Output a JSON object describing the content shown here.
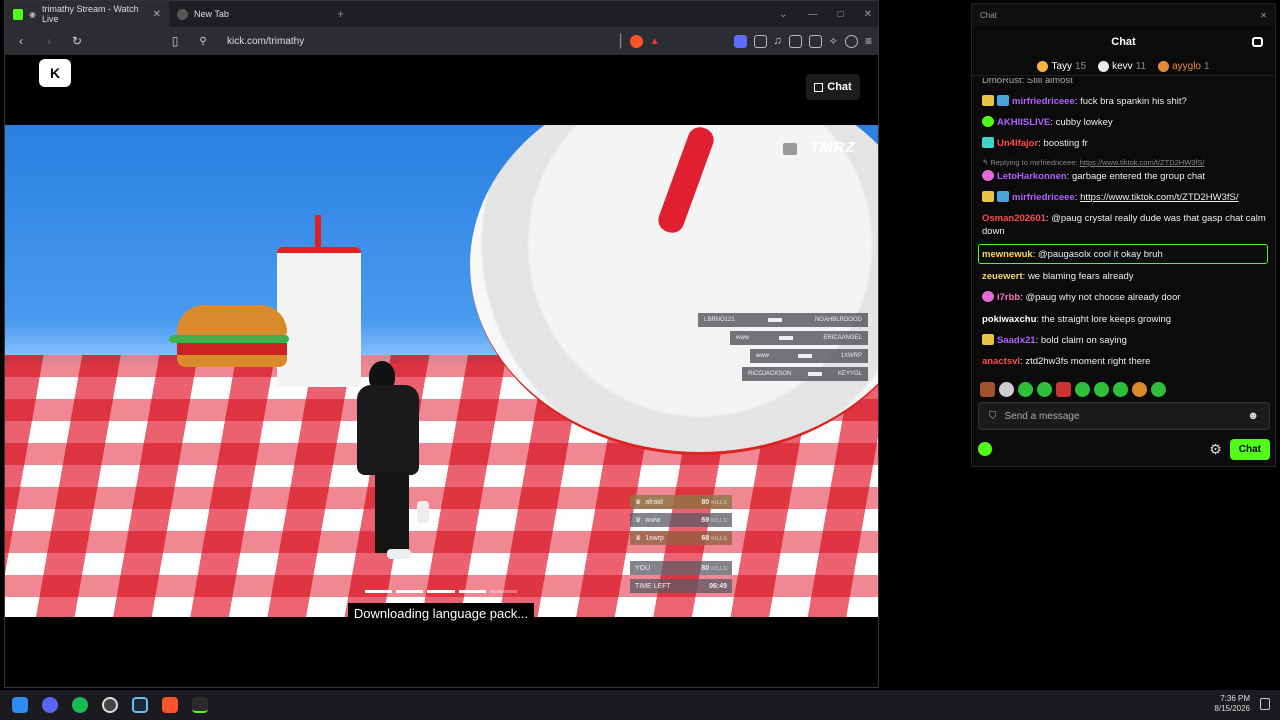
{
  "browser": {
    "tabs": [
      {
        "title": "trimathy Stream - Watch Live",
        "active": true
      },
      {
        "title": "New Tab",
        "active": false
      }
    ],
    "new_tab_symbol": "+",
    "url": "kick.com/trimathy",
    "window_controls": [
      "—",
      "□",
      "✕"
    ]
  },
  "page": {
    "chat_toggle_label": "Chat",
    "logo_text": "K"
  },
  "game": {
    "brand": "TMRZ",
    "killfeed": [
      {
        "killer": "LBRNO121",
        "victim": "NOAHBLRDOOD"
      },
      {
        "killer": "www",
        "victim": "ERICAANGEL"
      },
      {
        "killer": "www",
        "victim": "1XWRP"
      },
      {
        "killer": "RICOJACKSON",
        "victim": "KEYYGL"
      }
    ],
    "leaderboard": [
      {
        "name": "afraid",
        "value": "80",
        "unit": "KILLS"
      },
      {
        "name": "www",
        "value": "69",
        "unit": "KILLS"
      },
      {
        "name": "1xwrp",
        "value": "68",
        "unit": "KILLS"
      }
    ],
    "you": {
      "label": "YOU",
      "value": "80",
      "unit": "KILLS"
    },
    "time_left": {
      "label": "TIME LEFT",
      "value": "06:49"
    },
    "loading_progress": 0.8
  },
  "caption": "Downloading language pack...",
  "chat": {
    "window_title": "Chat",
    "header": "Chat",
    "gifters": [
      {
        "name": "Tayy",
        "count": "15",
        "color": "#f5b63b"
      },
      {
        "name": "kevv",
        "count": "11",
        "color": "#e9e9e9"
      },
      {
        "name": "ayyglo",
        "count": "1",
        "color": "#e58a3a"
      }
    ],
    "messages": [
      {
        "user": "mirfriedriceee",
        "color": "#b061ff",
        "badge": "#e8c547",
        "text": "fuck bra spankin his shit?"
      },
      {
        "user": "AKHIISLIVE",
        "color": "#b061ff",
        "badge": "#53fc18",
        "text": "cubby lowkey"
      },
      {
        "user": "Un4lfajor",
        "color": "#ff4d4d",
        "badge": "#3fd6c7",
        "text": "boosting fr"
      },
      {
        "user": "LetoHarkonnen",
        "color": "#b061ff",
        "badge": "#e26bd6",
        "text": "garbage entered the group chat"
      },
      {
        "user": "mirfriedriceee",
        "color": "#b061ff",
        "badge": "#e8c547",
        "text": "https://www.tiktok.com/t/ZTD2HW3fS/"
      },
      {
        "user": "Osman202601",
        "color": "#ff4d4d",
        "badge": "",
        "text": "@paug crystal really dude was that gasp chat calm down"
      },
      {
        "user": "mewnewuk",
        "color": "#f5d76e",
        "badge": "",
        "text": "@paugasolx cool it okay bruh"
      },
      {
        "user": "zeuewert",
        "color": "#f5d76e",
        "badge": "",
        "text": "we blaming fears already"
      },
      {
        "user": "i7rbb",
        "color": "#ff6ec7",
        "badge": "#e26bd6",
        "text": "@paug why not choose already door"
      },
      {
        "user": "pokiwaxchu",
        "color": "#ffffff",
        "badge": "",
        "text": "the straight lore keeps growing"
      },
      {
        "user": "Saadx21",
        "color": "#b061ff",
        "badge": "#e8c547",
        "text": "bold claim on saying"
      },
      {
        "user": "anactsvl",
        "color": "#ff4d4d",
        "badge": "",
        "text": "ztd2hw3fs moment right there"
      }
    ],
    "reply_label": "Replying to mirfriedriceee:",
    "reply_link": "https://www.tiktok.com/t/ZTD2HW3fS/",
    "top_partial": "DmoRust: Still almost",
    "input_placeholder": "Send a message",
    "send_label": "Chat"
  },
  "taskbar": {
    "apps": [
      "windows-start",
      "discord",
      "spotify",
      "obs",
      "steam",
      "brave",
      "kick"
    ],
    "time": "7:36 PM",
    "date": "8/15/2026"
  }
}
